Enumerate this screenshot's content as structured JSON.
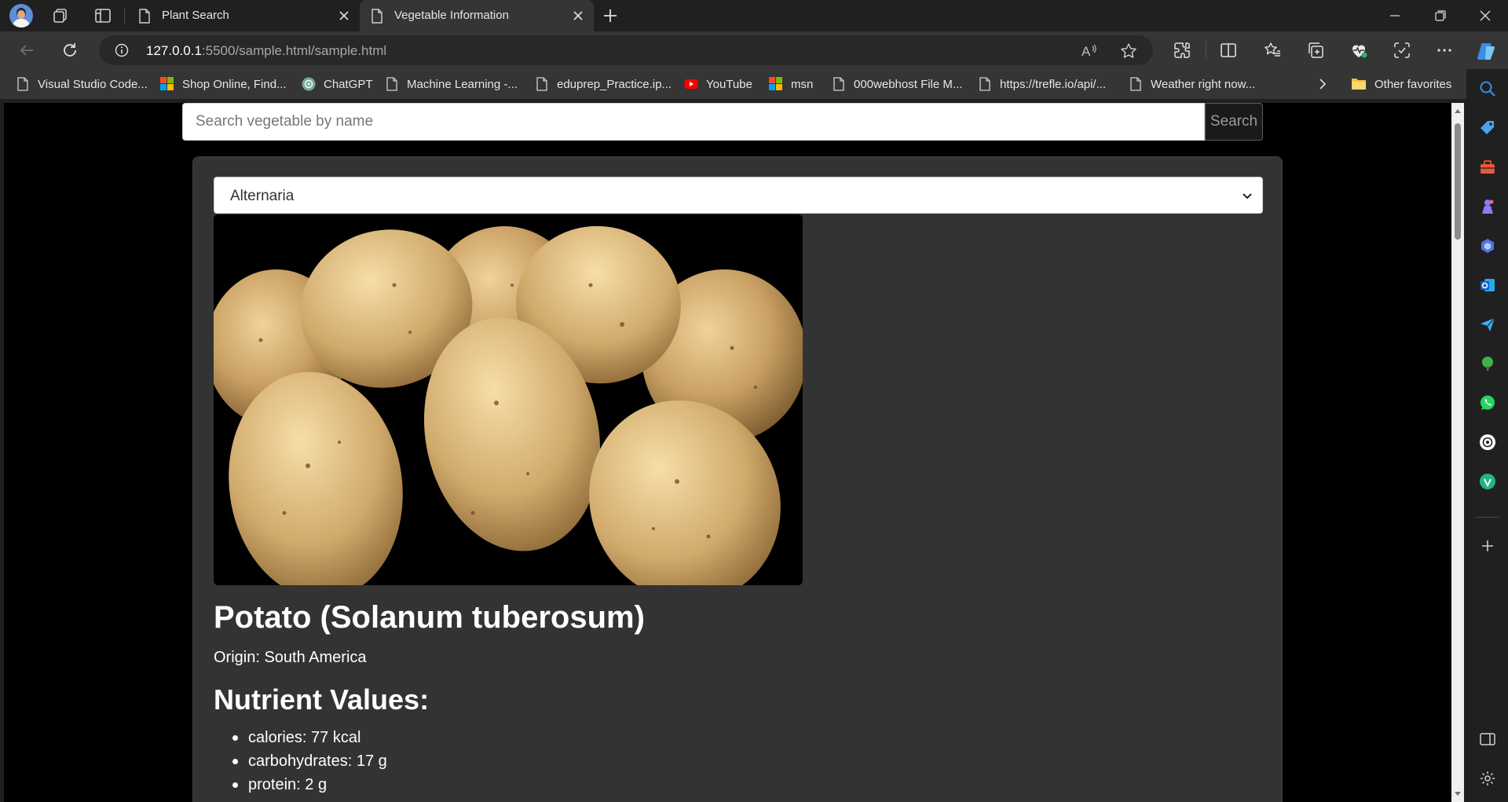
{
  "browser": {
    "tabs": [
      {
        "title": "Plant Search",
        "active": false
      },
      {
        "title": "Vegetable Information",
        "active": true
      }
    ],
    "address": {
      "host": "127.0.0.1",
      "path": ":5500/sample.html/sample.html"
    },
    "read_aloud_glyph": "A",
    "favorites": [
      {
        "label": "Visual Studio Code...",
        "icon": "page-icon"
      },
      {
        "label": "Shop Online, Find...",
        "icon": "microsoft-icon"
      },
      {
        "label": "ChatGPT",
        "icon": "chatgpt-icon"
      },
      {
        "label": "Machine Learning -...",
        "icon": "page-icon"
      },
      {
        "label": "eduprep_Practice.ip...",
        "icon": "page-icon"
      },
      {
        "label": "YouTube",
        "icon": "youtube-icon"
      },
      {
        "label": "msn",
        "icon": "microsoft-icon"
      },
      {
        "label": "000webhost File M...",
        "icon": "page-icon"
      },
      {
        "label": "https://trefle.io/api/...",
        "icon": "page-icon"
      },
      {
        "label": "Weather right now...",
        "icon": "page-icon"
      }
    ],
    "other_favorites": "Other favorites",
    "accent": "#5b8fd6"
  },
  "page": {
    "search": {
      "placeholder": "Search vegetable by name",
      "button_label": "Search"
    },
    "disease_select": {
      "selected": "Alternaria"
    },
    "vegetable": {
      "title": "Potato (Solanum tuberosum)",
      "origin": "Origin: South America",
      "nutrients_heading": "Nutrient Values:",
      "nutrients": [
        "calories: 77 kcal",
        "carbohydrates: 17 g",
        "protein: 2 g"
      ]
    }
  }
}
